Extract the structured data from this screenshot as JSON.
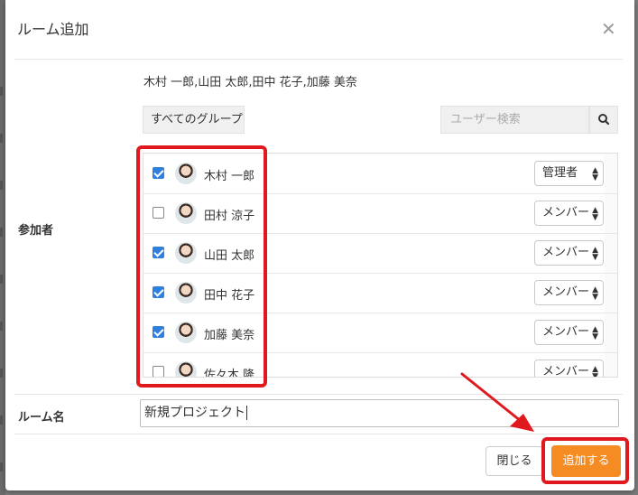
{
  "modal": {
    "title": "ルーム追加",
    "close_icon": "close-icon"
  },
  "participants": {
    "label": "参加者",
    "selected_summary": "木村 一郎,山田 太郎,田中 花子,加藤 美奈",
    "group_button": "すべてのグループ",
    "search_placeholder": "ユーザー検索",
    "search_icon": "search-icon",
    "users": [
      {
        "name": "木村 一郎",
        "checked": true,
        "role": "管理者"
      },
      {
        "name": "田村 涼子",
        "checked": false,
        "role": "メンバー"
      },
      {
        "name": "山田 太郎",
        "checked": true,
        "role": "メンバー"
      },
      {
        "name": "田中 花子",
        "checked": true,
        "role": "メンバー"
      },
      {
        "name": "加藤 美奈",
        "checked": true,
        "role": "メンバー"
      },
      {
        "name": "佐々木 隆",
        "checked": false,
        "role": "メンバー"
      }
    ]
  },
  "room_name": {
    "label": "ルーム名",
    "value": "新規プロジェクト"
  },
  "footer": {
    "close_label": "閉じる",
    "add_label": "追加する"
  },
  "colors": {
    "accent": "#f58c23",
    "checkbox": "#2f7fdf",
    "annotation": "#e0191e"
  }
}
